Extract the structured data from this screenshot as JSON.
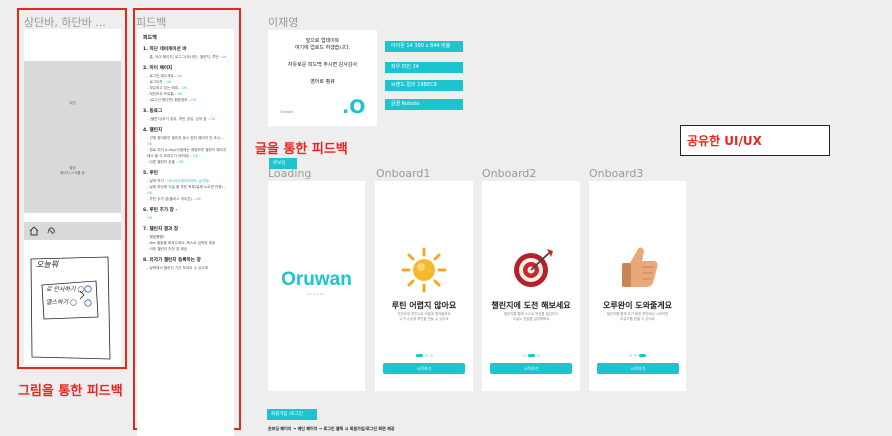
{
  "frames": {
    "sketch_title": "상단바, 하단바 ...",
    "feedback_title": "피드백",
    "designer_title": "이재영"
  },
  "sketch": {
    "placeholder1": "네컷",
    "placeholder2_line1": "별점",
    "placeholder2_line2": "페이지 스크롤 등",
    "handwriting_1": "오늘뭐",
    "handwriting_2": "로 인사하기 ◯",
    "handwriting_3": "엘스하기 ◯"
  },
  "labels": {
    "drawing_feedback": "그림을 통한 피드백",
    "text_feedback": "글을 통한 피드백",
    "shared_uiux": "공유한 UI/UX"
  },
  "feedback": {
    "heading": "피드백",
    "sections": [
      {
        "title": "1. 하단 네비게이션 바",
        "lines": [
          [
            "- 홈, 아이 페이지, 로그그(게시판), 챌린지, 루틴 - ",
            "ok"
          ]
        ]
      },
      {
        "title": "2. 마이 페이지",
        "lines": [
          [
            "- 로그인 해주세요 - ",
            "ok"
          ],
          [
            "- 로그아웃 - ",
            "OK"
          ],
          [
            "- 보유하고 있는 에피 - ",
            "OK"
          ],
          [
            "- 레인보우 프로필 - ",
            "OK"
          ],
          [
            "- (로그인 했다면) 회원정보 - ",
            "OK"
          ]
        ]
      },
      {
        "title": "3. 동료그",
        "lines": [
          [
            "- (챌린지)후기 공유, 루틴 공유, 검색 등 - ",
            "OK"
          ]
        ]
      },
      {
        "title": "4. 챌린지",
        "lines": [
          [
            "- 전체 참여중인 챌린지 동시 뭔지 페이지 만 추시, - ",
            "OK"
          ],
          [
            "- 완료 치지 d-day(다음에는 예정하루 챌린지 페이지에서 볼 각 보여주기 어려워) - ",
            "OK"
          ],
          [
            "- 다른 챌린지 호출 - ",
            "OK"
          ]
        ]
      },
      {
        "title": "5. 루틴",
        "lines": [
          [
            "- 달력 보기 - ",
            "OK(아이페이지에도 넣어줘)"
          ],
          [
            "- 날짜 하단에 오늘 할 루틴 목록(날짜 누르면 반응) - ",
            "OK"
          ],
          [
            "- 루틴 추가 칩(플러스 아이콘) - ",
            "OK"
          ]
        ]
      },
      {
        "title": "6. 루틴 추가 창 - ",
        "lines": [
          [
            "",
            "OK"
          ]
        ]
      },
      {
        "title": "7. 챌린지 결과 창",
        "lines": [
          [
            "- 햇빛쨍쨍?",
            ""
          ],
          [
            "- like 별점을 메겨주세요, 텍스트 입력창 제공",
            ""
          ],
          [
            "- 이후 챌린지 추천 창 제공",
            ""
          ]
        ]
      },
      {
        "title": "8. 유저가 챌린지 등록하는 창",
        "lines": [
          [
            "- 달력에서 챌린지 기간 보세요 수 있도록",
            ""
          ]
        ]
      }
    ]
  },
  "spec": {
    "intro_line1": "앞으로 업데이트",
    "intro_line2": "여기에 업로드 하겠습니다.",
    "intro_line3": "자유로운 피드백 주시면 감사감사",
    "intro_line4": "영어로 평큐",
    "small_caption": "Oruwan",
    "logo_mark": ".O",
    "items": [
      "아이폰 14 390 x 844 비율",
      "좌우 마진 24",
      "브랜드 컬러 19BEC9",
      "글꼴 Roboto"
    ],
    "chip": "온보딩"
  },
  "screens": {
    "loading_title": "Loading",
    "loading_logo": "Oruwan",
    "loading_sub": "Oruwan",
    "onboards": [
      {
        "frame_title": "Onboard1",
        "icon": "sun-icon",
        "title": "루틴 어렵지 않아요",
        "sub1": "간단하게 루틴으로 어떻게 챙겨볼까요",
        "sub2": "누구나 쉽게 루틴을 만들 수 있어요",
        "button": "시작하기",
        "active_dot": 0
      },
      {
        "frame_title": "Onboard2",
        "icon": "target-icon",
        "title": "챌린지에 도전 해보세요",
        "sub1": "챌린지를 통해 스스로 목표를 달성하고",
        "sub2": "오늘도 한걸음 성장해봐요",
        "button": "시작하기",
        "active_dot": 1
      },
      {
        "frame_title": "Onboard3",
        "icon": "thumbs-up-icon",
        "title": "오루완이 도와줄게요",
        "sub1": "챌린지를 함께 하기 위한 루틴에서 시작하면",
        "sub2": "리워드를 받을 수 있어요",
        "button": "시작하기",
        "active_dot": 2
      }
    ]
  },
  "bottom": {
    "chip": "회원가입 /로그인",
    "caption": "온보딩 페이지 → 메인 페이지 → 로그인 클릭 시 회원가입/로그인 화면 제공"
  },
  "colors": {
    "brand": "#1CC4CF",
    "annotation_red": "#E8261F"
  }
}
